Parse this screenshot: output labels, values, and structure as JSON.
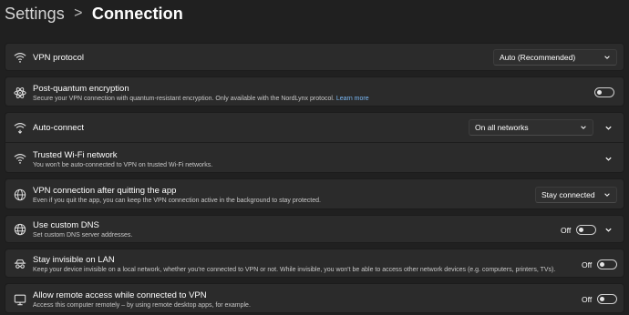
{
  "breadcrumb": {
    "parent": "Settings",
    "separator": ">",
    "current": "Connection"
  },
  "settings": {
    "vpn_protocol": {
      "icon": "vpn-protocol-icon",
      "title": "VPN protocol",
      "value": "Auto (Recommended)"
    },
    "post_quantum": {
      "icon": "atom-icon",
      "title": "Post-quantum encryption",
      "desc": "Secure your VPN connection with quantum-resistant encryption. Only available with the NordLynx protocol.",
      "link": "Learn more",
      "enabled": false
    },
    "auto_connect": {
      "icon": "wifi-auto-icon",
      "title": "Auto-connect",
      "value": "On all networks"
    },
    "trusted_wifi": {
      "icon": "wifi-icon",
      "title": "Trusted Wi-Fi network",
      "desc": "You won't be auto-connected to VPN on trusted Wi-Fi networks."
    },
    "after_quit": {
      "icon": "globe-icon",
      "title": "VPN connection after quitting the app",
      "desc": "Even if you quit the app, you can keep the VPN connection active in the background to stay protected.",
      "value": "Stay connected"
    },
    "custom_dns": {
      "icon": "dns-globe-icon",
      "title": "Use custom DNS",
      "desc": "Set custom DNS server addresses.",
      "toggle_label": "Off",
      "enabled": false
    },
    "invisible_lan": {
      "icon": "incognito-icon",
      "title": "Stay invisible on LAN",
      "desc": "Keep your device invisible on a local network, whether you're connected to VPN or not. While invisible, you won't be able to access other network devices (e.g. computers, printers, TVs).",
      "toggle_label": "Off",
      "enabled": false
    },
    "remote_access": {
      "icon": "remote-desktop-icon",
      "title": "Allow remote access while connected to VPN",
      "desc": "Access this computer remotely – by using remote desktop apps, for example.",
      "toggle_label": "Off",
      "enabled": false
    }
  }
}
